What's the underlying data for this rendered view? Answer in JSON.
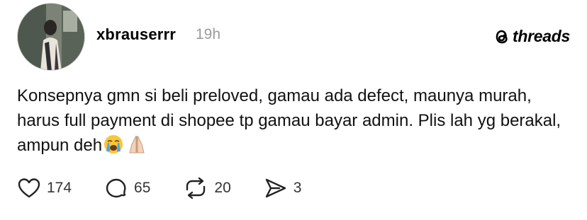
{
  "post": {
    "username": "xbrauserrr",
    "time": "19h",
    "text": "Konsepnya gmn si beli preloved, gamau ada defect, maunya murah, harus full payment di shopee tp gamau bayar admin. Plis lah yg berakal, ampun deh",
    "emojis": [
      "crying-face",
      "folded-hands"
    ]
  },
  "brand": {
    "logo_text": "threads"
  },
  "actions": {
    "likes": "174",
    "replies": "65",
    "reposts": "20",
    "shares": "3"
  },
  "colors": {
    "text": "#000000",
    "secondary": "#9a9a9a",
    "background": "#ffffff"
  }
}
